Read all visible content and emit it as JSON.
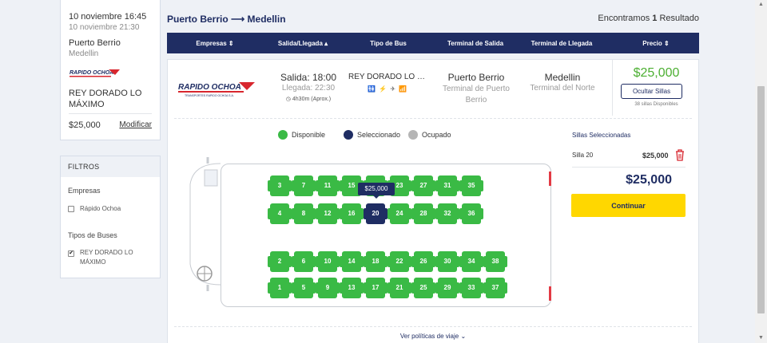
{
  "trip": {
    "date": "10 noviembre 16:45",
    "date_sub": "10 noviembre 21:30",
    "origin": "Puerto Berrio",
    "destination": "Medellin",
    "logo_text": "RAPIDO OCHOA",
    "bus_type": "REY DORADO LO MÁXIMO",
    "price": "$25,000",
    "modify": "Modificar"
  },
  "filters": {
    "title": "FILTROS",
    "companies_label": "Empresas",
    "company_option": "Rápido Ochoa",
    "bus_types_label": "Tipos de Buses",
    "bus_type_option": "REY DORADO LO MÁXIMO",
    "company_checked": false,
    "bus_type_checked": true
  },
  "header": {
    "route": "Puerto Berrio ⟶ Medellin",
    "results_prefix": "Encontramos",
    "results_count": "1",
    "results_suffix": "Resultado"
  },
  "table": {
    "columns": [
      "Empresas ⇕",
      "Salida/Llegada ▴",
      "Tipo de Bus",
      "Terminal de Salida",
      "Terminal de Llegada",
      "Precio ⇕"
    ]
  },
  "result": {
    "logo_text": "RAPIDO OCHOA",
    "logo_subtext": "TRANSPORTES RAPIDO OCHOA S.A.",
    "departure": "Salida: 18:00",
    "arrival": "Llegada: 22:30",
    "duration": "◷ 4h30m (Aprox.)",
    "bus_name": "REY DORADO LO MÁXIMO",
    "amenities": "🚻 ⚡ ✈ 📶",
    "terminal_departure": "Puerto Berrio",
    "terminal_departure_sub": "Terminal de Puerto Berrio",
    "terminal_arrival": "Medellin",
    "terminal_arrival_sub": "Terminal del Norte",
    "price": "$25,000",
    "hide_seats": "Ocultar Sillas",
    "seats_available": "38 sillas Disponibles"
  },
  "legend": {
    "available": "Disponible",
    "selected": "Seleccionado",
    "occupied": "Ocupado",
    "available_color": "#3aba45",
    "selected_color": "#1f2d63",
    "occupied_color": "#b5b5b5"
  },
  "seats": {
    "row1": [
      "3",
      "7",
      "11",
      "15",
      "19",
      "23",
      "27",
      "31",
      "35"
    ],
    "row2": [
      "4",
      "8",
      "12",
      "16",
      "20",
      "24",
      "28",
      "32",
      "36"
    ],
    "row3": [
      "2",
      "6",
      "10",
      "14",
      "18",
      "22",
      "26",
      "30",
      "34",
      "38"
    ],
    "row4": [
      "1",
      "5",
      "9",
      "13",
      "17",
      "21",
      "25",
      "29",
      "33",
      "37"
    ],
    "selected_seat": "20",
    "tooltip": "$25,000"
  },
  "selection": {
    "title": "Sillas Seleccionadas",
    "seat_label": "Silla 20",
    "seat_price": "$25,000",
    "total": "$25,000",
    "continue": "Continuar"
  },
  "footer": {
    "policies": "Ver políticas de viaje ⌄"
  }
}
